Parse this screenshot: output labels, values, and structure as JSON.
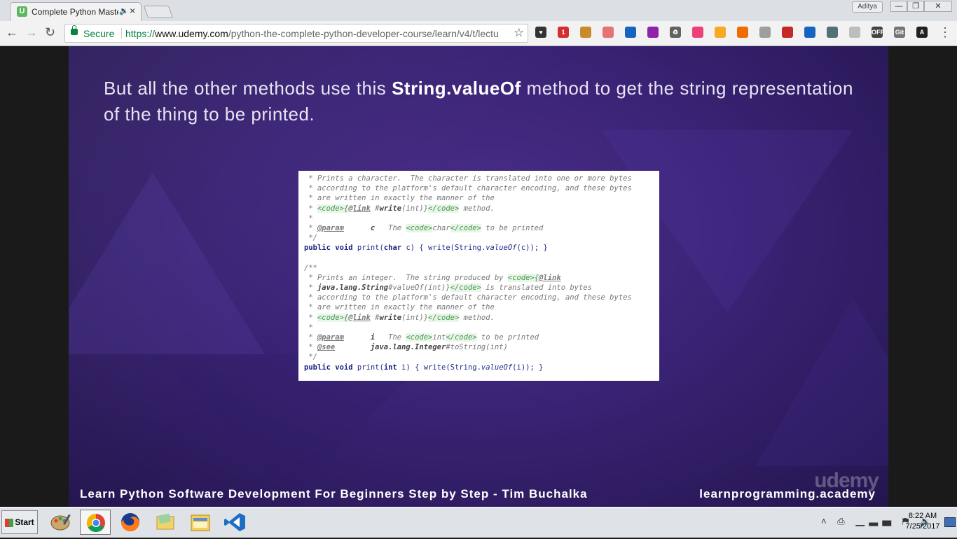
{
  "browser": {
    "tab": {
      "title": "Complete Python Maste",
      "favicon": "U",
      "audio_icon": "🔉",
      "close_icon": "×"
    },
    "profile_name": "Aditya",
    "window_controls": {
      "minimize": "—",
      "restore": "❐",
      "close": "✕"
    },
    "nav": {
      "back": "←",
      "forward": "→",
      "reload": "↻"
    },
    "omnibox": {
      "secure_label": "Secure",
      "url_scheme": "https://",
      "url_host": "www.udemy.com",
      "url_path": "/python-the-complete-python-developer-course/learn/v4/t/lectu"
    },
    "star_icon": "☆",
    "menu_icon": "⋮",
    "extensions": [
      {
        "name": "pocket-icon",
        "color": "#333333",
        "label": "♥"
      },
      {
        "name": "opera-badge-icon",
        "color": "#d32f2f",
        "label": "1"
      },
      {
        "name": "ruler-icon",
        "color": "#c98a2b",
        "label": ""
      },
      {
        "name": "panel-icon",
        "color": "#e57373",
        "label": ""
      },
      {
        "name": "eyedropper-icon",
        "color": "#1565c0",
        "label": ""
      },
      {
        "name": "colorwheel-icon",
        "color": "#8e24aa",
        "label": ""
      },
      {
        "name": "recycle-icon",
        "color": "#616161",
        "label": "♻"
      },
      {
        "name": "gradient-icon",
        "color": "#ec407a",
        "label": ""
      },
      {
        "name": "note-icon",
        "color": "#f9a825",
        "label": ""
      },
      {
        "name": "bowl-icon",
        "color": "#ef6c00",
        "label": ""
      },
      {
        "name": "hex-icon",
        "color": "#9e9e9e",
        "label": ""
      },
      {
        "name": "lastpass-icon",
        "color": "#c62828",
        "label": ""
      },
      {
        "name": "save-icon",
        "color": "#1565c0",
        "label": ""
      },
      {
        "name": "copy-icon",
        "color": "#546e7a",
        "label": ""
      },
      {
        "name": "circle-icon",
        "color": "#bdbdbd",
        "label": ""
      },
      {
        "name": "off-icon",
        "color": "#424242",
        "label": "OFF"
      },
      {
        "name": "gitzip-icon",
        "color": "#757575",
        "label": "Git"
      },
      {
        "name": "account-icon",
        "color": "#212121",
        "label": "A"
      }
    ]
  },
  "slide": {
    "text_before": "But all the other methods use this ",
    "text_bold": "String.valueOf",
    "text_after": " method to get the string representation of the thing to be printed.",
    "code_lines": [
      " * Prints a character.  The character is translated into one or more bytes",
      " * according to the platform's default character encoding, and these bytes",
      " * are written in exactly the manner of the",
      " * <code>{@link #write(int)}</code> method.",
      " *",
      " * @param      c   The <code>char</code> to be printed",
      " */",
      "public void print(char c) { write(String.valueOf(c)); }",
      "",
      "/**",
      " * Prints an integer.  The string produced by <code>{@link",
      " * java.lang.String#valueOf(int)}</code> is translated into bytes",
      " * according to the platform's default character encoding, and these bytes",
      " * are written in exactly the manner of the",
      " * <code>{@link #write(int)}</code> method.",
      " *",
      " * @param      i   The <code>int</code> to be printed",
      " * @see        java.lang.Integer#toString(int)",
      " */",
      "public void print(int i) { write(String.valueOf(i)); }"
    ],
    "footer_left": "Learn Python Software Development For Beginners Step by Step - Tim Buchalka",
    "footer_right": "learnprogramming.academy",
    "watermark": "udemy"
  },
  "taskbar": {
    "start_label": "Start",
    "apps": [
      {
        "name": "paint-taskbar-icon",
        "active": false
      },
      {
        "name": "chrome-taskbar-icon",
        "active": true
      },
      {
        "name": "firefox-taskbar-icon",
        "active": false
      },
      {
        "name": "folder-taskbar-icon",
        "active": false
      },
      {
        "name": "explorer-taskbar-icon",
        "active": false
      },
      {
        "name": "vscode-taskbar-icon",
        "active": false
      }
    ],
    "tray_icons": "˄ ⎙ ▁▃▅ ⚑ 🔉",
    "clock_time": "8:22 AM",
    "clock_date": "7/25/2017"
  }
}
